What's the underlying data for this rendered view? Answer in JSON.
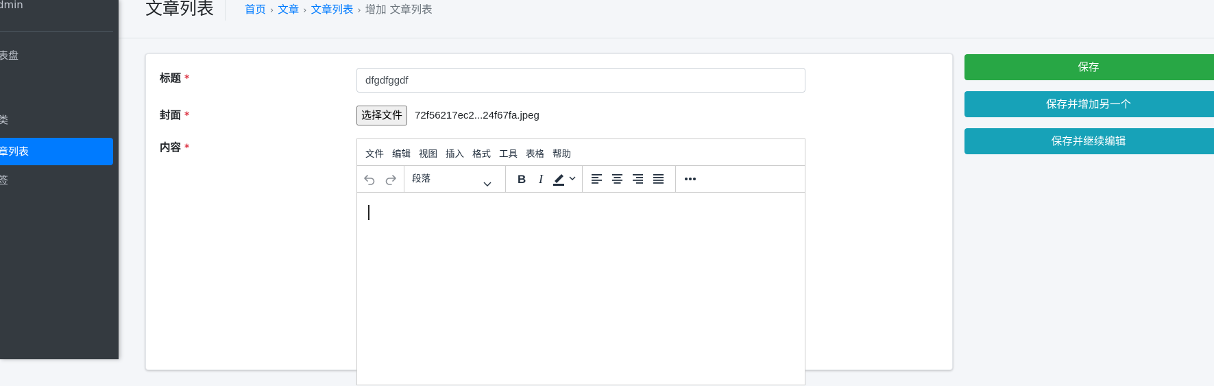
{
  "sidebar": {
    "user": "dmin",
    "items": [
      {
        "label": "表盘"
      },
      {
        "label": "类"
      },
      {
        "label": "章列表",
        "active": true
      },
      {
        "label": "签"
      }
    ]
  },
  "header": {
    "title": "文章列表",
    "breadcrumb": [
      "首页",
      "文章",
      "文章列表"
    ],
    "breadcrumb_current": "增加 文章列表"
  },
  "form": {
    "title_label": "标题",
    "title_value": "dfgdfggdf",
    "cover_label": "封面",
    "cover_button": "选择文件",
    "cover_filename": "72f56217ec2...24f67fa.jpeg",
    "content_label": "内容",
    "required_mark": "*"
  },
  "editor": {
    "menu": [
      "文件",
      "编辑",
      "视图",
      "插入",
      "格式",
      "工具",
      "表格",
      "帮助"
    ],
    "block_format": "段落",
    "icons": {
      "undo": "undo-icon",
      "redo": "redo-icon",
      "bold": "bold-icon",
      "italic": "italic-icon",
      "highlight": "highlight-icon",
      "align_left": "align-left-icon",
      "align_center": "align-center-icon",
      "align_right": "align-right-icon",
      "justify": "justify-icon",
      "more": "more-icon"
    }
  },
  "actions": {
    "save": "保存",
    "save_add_another": "保存并增加另一个",
    "save_continue": "保存并继续编辑"
  },
  "colors": {
    "sidebar_bg": "#343a40",
    "active_item": "#007bff",
    "save_button": "#28a745",
    "info_button": "#17a2b8",
    "link": "#007bff",
    "required": "#dc3545"
  }
}
